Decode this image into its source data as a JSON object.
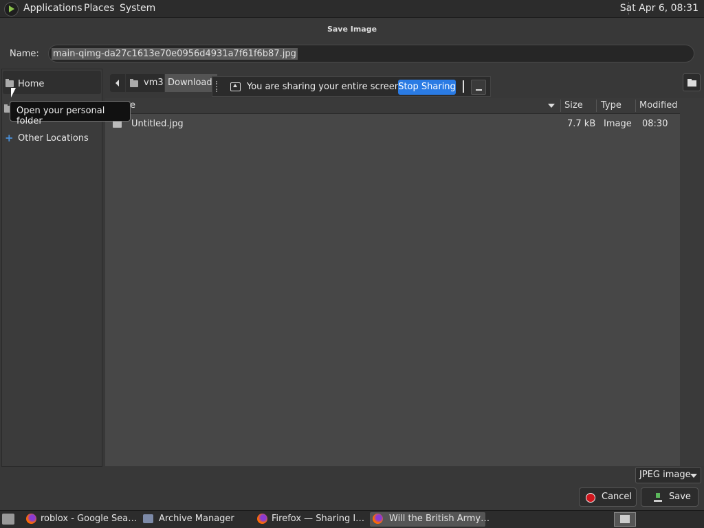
{
  "top_panel": {
    "menus": [
      "Applications",
      "Places",
      "System"
    ],
    "clock": "Sat Apr  6, 08:31"
  },
  "dialog": {
    "title": "Save Image",
    "name_label": "Name:",
    "filename": "main-qimg-da27c1613e70e0956d4931a7f61f6b87.jpg"
  },
  "sidebar": {
    "items": [
      {
        "label": "Home",
        "icon": "home-folder-icon"
      },
      {
        "label": "Other Locations",
        "icon": "plus-icon"
      }
    ],
    "tooltip": "Open your personal folder"
  },
  "pathbar": {
    "segments": [
      "vm3",
      "Download"
    ]
  },
  "sharing": {
    "message": "You are sharing your entire screen.",
    "stop_label": "Stop Sharing"
  },
  "columns": {
    "name": "e",
    "size": "Size",
    "type": "Type",
    "modified": "Modified"
  },
  "files": [
    {
      "name": "Untitled.jpg",
      "size": "7.7 kB",
      "type": "Image",
      "modified": "08:30"
    }
  ],
  "footer": {
    "filetype": "JPEG image",
    "cancel_label": "Cancel",
    "save_label": "Save"
  },
  "taskbar": {
    "tasks": [
      {
        "label": "roblox - Google Sea…",
        "icon": "firefox-icon"
      },
      {
        "label": "Archive Manager",
        "icon": "archive-manager-icon"
      },
      {
        "label": "Firefox — Sharing I…",
        "icon": "firefox-icon"
      },
      {
        "label": "Will the British Army…",
        "icon": "firefox-icon"
      }
    ]
  },
  "colors": {
    "accent": "#2a7be4",
    "cancel_red": "#d0161d",
    "panel": "#2c2c2c"
  }
}
